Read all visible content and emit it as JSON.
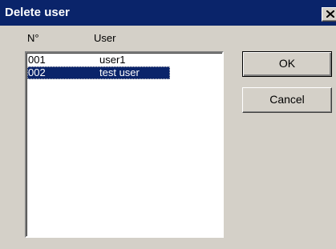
{
  "window": {
    "title": "Delete user",
    "close_glyph": "close-icon"
  },
  "columns": {
    "number": "N°",
    "user": "User"
  },
  "users": [
    {
      "number": "001",
      "name": "user1",
      "selected": false
    },
    {
      "number": "002",
      "name": "test user",
      "selected": true
    }
  ],
  "buttons": {
    "ok": "OK",
    "cancel": "Cancel"
  },
  "colors": {
    "titlebar": "#0a246a",
    "face": "#d4d0c8",
    "selection": "#0a246a"
  }
}
